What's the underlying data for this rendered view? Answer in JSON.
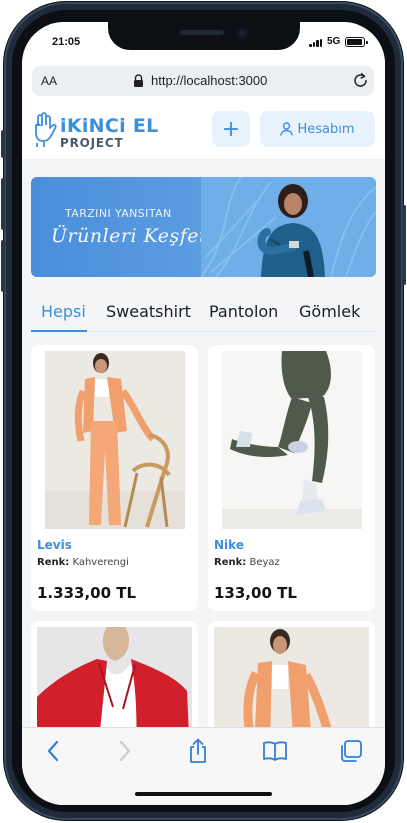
{
  "status_bar": {
    "time": "21:05",
    "network": "5G"
  },
  "browser": {
    "text_size_label": "AA",
    "url": "http://localhost:3000"
  },
  "header": {
    "logo_title": "iKiNCi EL",
    "logo_subtitle": "PROJECT",
    "add_label": "+",
    "account_label": "Hesabım"
  },
  "banner": {
    "line1": "TARZINI YANSITAN",
    "line2": "Ürünleri Keşfet"
  },
  "tabs": [
    {
      "label": "Hepsi",
      "active": true
    },
    {
      "label": "Sweatshirt",
      "active": false
    },
    {
      "label": "Pantolon",
      "active": false
    },
    {
      "label": "Gömlek",
      "active": false
    }
  ],
  "product_field_label": "Renk:",
  "products": [
    {
      "brand": "Levis",
      "color": "Kahverengi",
      "price": "1.333,00 TL"
    },
    {
      "brand": "Nike",
      "color": "Beyaz",
      "price": "133,00 TL"
    }
  ],
  "colors": {
    "accent": "#3b8fdc",
    "accent_light": "#e8f2fc",
    "banner": "#4a8edb",
    "page_bg": "#f4f5f7"
  }
}
